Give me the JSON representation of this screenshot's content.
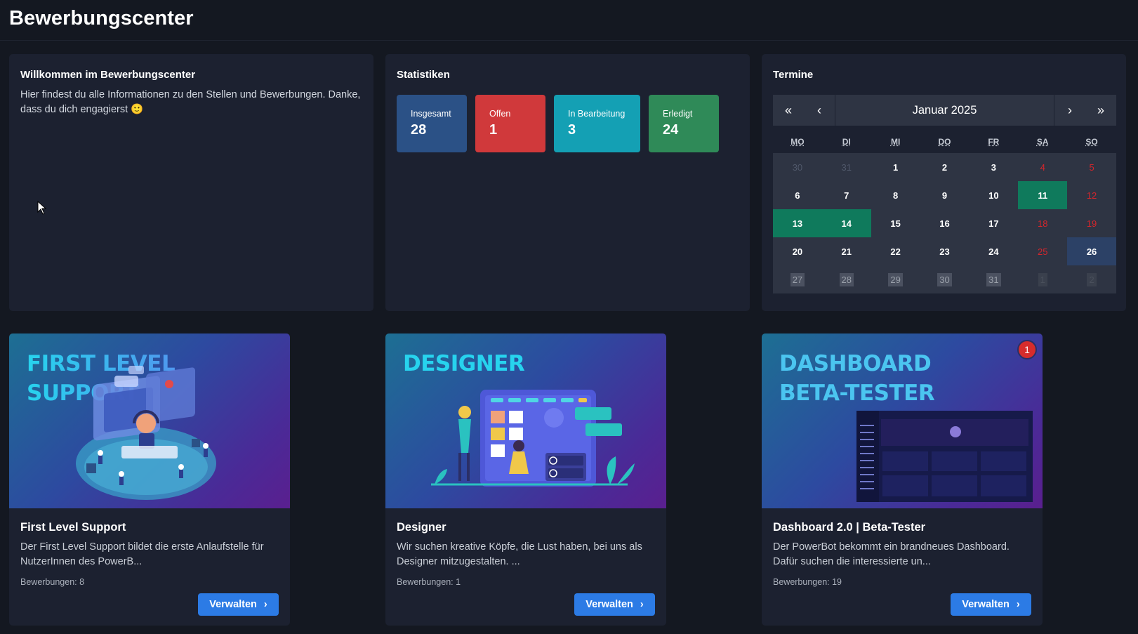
{
  "header": {
    "title": "Bewerbungscenter"
  },
  "welcome": {
    "title": "Willkommen im Bewerbungscenter",
    "text": "Hier findest du alle Informationen zu den Stellen und Bewerbungen. Danke, dass du dich engagierst 🙂"
  },
  "stats": {
    "title": "Statistiken",
    "items": [
      {
        "label": "Insgesamt",
        "value": "28",
        "color": "#2b5186"
      },
      {
        "label": "Offen",
        "value": "1",
        "color": "#d0393b"
      },
      {
        "label": "In Bearbeitung",
        "value": "3",
        "color": "#14a0b4"
      },
      {
        "label": "Erledigt",
        "value": "24",
        "color": "#2f8a58"
      }
    ]
  },
  "calendar": {
    "title": "Termine",
    "month_label": "Januar 2025",
    "nav": {
      "prev_year": "«",
      "prev_month": "‹",
      "next_month": "›",
      "next_year": "»"
    },
    "weekdays": [
      "MO",
      "DI",
      "MI",
      "DO",
      "FR",
      "SA",
      "SO"
    ],
    "weeks": [
      [
        {
          "d": "30",
          "t": "other"
        },
        {
          "d": "31",
          "t": "other"
        },
        {
          "d": "1",
          "t": "day"
        },
        {
          "d": "2",
          "t": "day"
        },
        {
          "d": "3",
          "t": "day"
        },
        {
          "d": "4",
          "t": "weekend"
        },
        {
          "d": "5",
          "t": "weekend"
        }
      ],
      [
        {
          "d": "6",
          "t": "day"
        },
        {
          "d": "7",
          "t": "day"
        },
        {
          "d": "8",
          "t": "day"
        },
        {
          "d": "9",
          "t": "day"
        },
        {
          "d": "10",
          "t": "day"
        },
        {
          "d": "11",
          "t": "event"
        },
        {
          "d": "12",
          "t": "weekend"
        }
      ],
      [
        {
          "d": "13",
          "t": "event"
        },
        {
          "d": "14",
          "t": "event"
        },
        {
          "d": "15",
          "t": "day"
        },
        {
          "d": "16",
          "t": "day"
        },
        {
          "d": "17",
          "t": "day"
        },
        {
          "d": "18",
          "t": "weekend"
        },
        {
          "d": "19",
          "t": "weekend"
        }
      ],
      [
        {
          "d": "20",
          "t": "day"
        },
        {
          "d": "21",
          "t": "day"
        },
        {
          "d": "22",
          "t": "day"
        },
        {
          "d": "23",
          "t": "day"
        },
        {
          "d": "24",
          "t": "day"
        },
        {
          "d": "25",
          "t": "weekend"
        },
        {
          "d": "26",
          "t": "today"
        }
      ],
      [
        {
          "d": "27",
          "t": "next"
        },
        {
          "d": "28",
          "t": "next"
        },
        {
          "d": "29",
          "t": "next"
        },
        {
          "d": "30",
          "t": "next"
        },
        {
          "d": "31",
          "t": "next"
        },
        {
          "d": "1",
          "t": "nextweekend"
        },
        {
          "d": "2",
          "t": "nextweekend"
        }
      ]
    ]
  },
  "positions": [
    {
      "banner": "FIRST LEVEL SUPPORT",
      "title": "First Level Support",
      "description": "Der First Level Support bildet die erste Anlaufstelle für NutzerInnen des PowerB...",
      "applications": "Bewerbungen: 8",
      "button": "Verwalten",
      "badge": ""
    },
    {
      "banner": "DESIGNER",
      "title": "Designer",
      "description": "Wir suchen kreative Köpfe, die Lust haben, bei uns als Designer mitzugestalten. ...",
      "applications": "Bewerbungen: 1",
      "button": "Verwalten",
      "badge": ""
    },
    {
      "banner": "DASHBOARD BETA-TESTER",
      "banner_line1": "DASHBOARD",
      "banner_line2": "BETA-TESTER",
      "title": "Dashboard 2.0 | Beta-Tester",
      "description": "Der PowerBot bekommt ein brandneues Dashboard. Dafür suchen die interessierte un...",
      "applications": "Bewerbungen: 19",
      "button": "Verwalten",
      "badge": "1"
    }
  ],
  "icons": {
    "chevron": "chevron-right-icon",
    "cursor": "mouse-cursor-icon"
  },
  "colors": {
    "accent": "#2c7be5",
    "event": "#0f7a5c",
    "today": "#2c4166",
    "weekend": "#d4262c"
  }
}
